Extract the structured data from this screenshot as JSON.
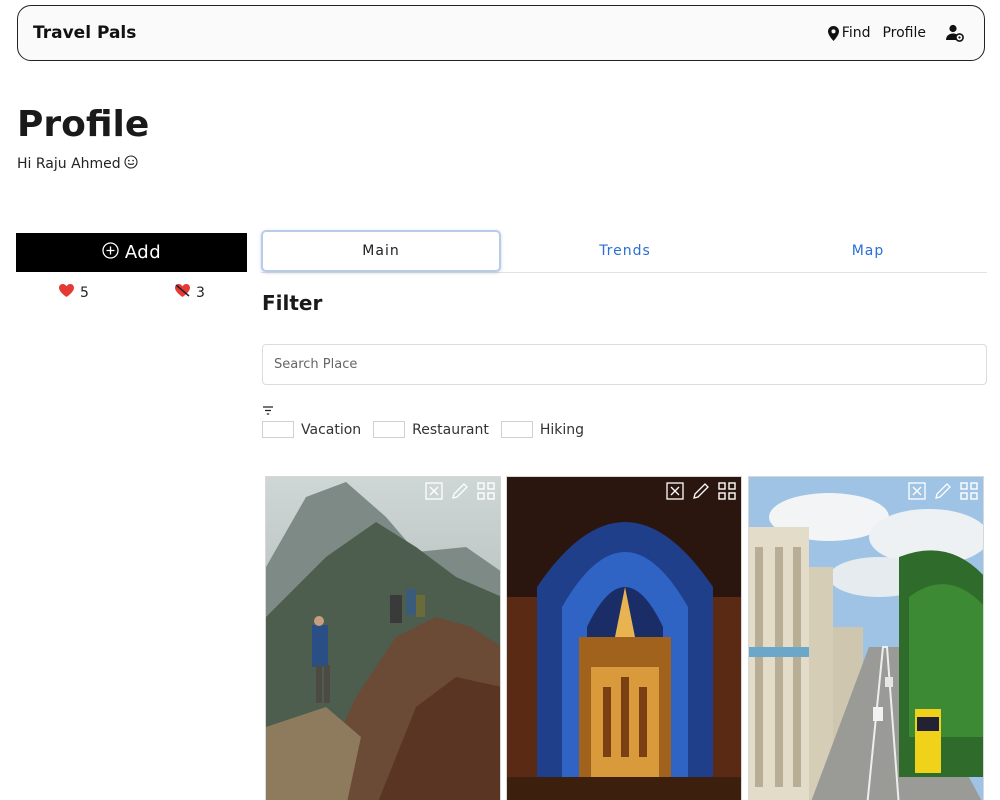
{
  "header": {
    "brand": "Travel Pals",
    "find_label": "Find",
    "profile_label": "Profile"
  },
  "page": {
    "title": "Profile",
    "greeting": "Hi Raju Ahmed"
  },
  "sidebar": {
    "add_label": "Add",
    "likes_count": "5",
    "dislikes_count": "3"
  },
  "tabs": [
    {
      "label": "Main",
      "active": true
    },
    {
      "label": "Trends",
      "active": false
    },
    {
      "label": "Map",
      "active": false
    }
  ],
  "filter": {
    "title": "Filter",
    "search_placeholder": "Search Place",
    "categories": [
      "Vacation",
      "Restaurant",
      "Hiking"
    ]
  },
  "cards": [
    {
      "subject": "mountain hikers"
    },
    {
      "subject": "cathedral interior"
    },
    {
      "subject": "city street"
    }
  ],
  "colors": {
    "accent_blue": "#2a6fd6",
    "heart_red": "#e53935",
    "add_button_bg": "#000000"
  }
}
